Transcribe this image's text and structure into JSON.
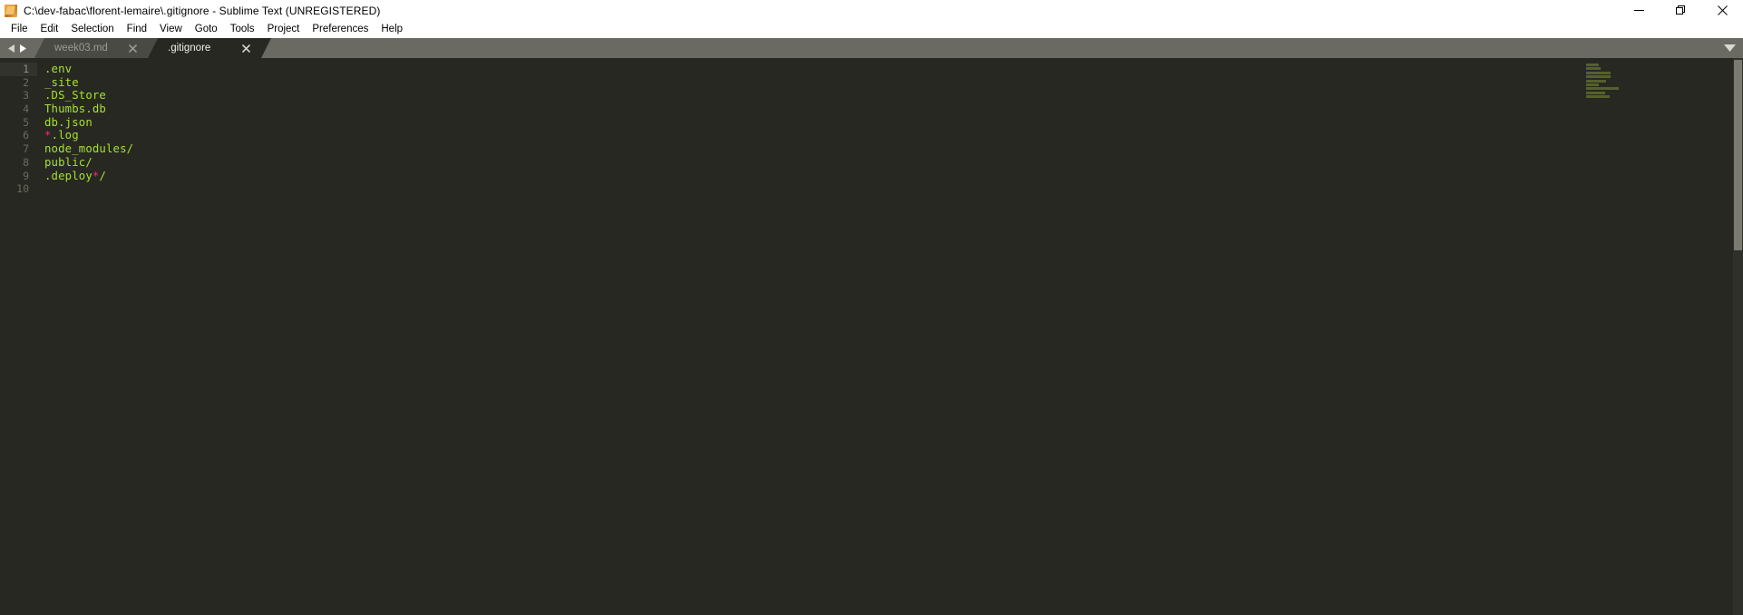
{
  "window": {
    "title": "C:\\dev-fabac\\florent-lemaire\\.gitignore - Sublime Text (UNREGISTERED)",
    "app_icon": "sublime-text-icon",
    "controls": [
      {
        "name": "minimize",
        "glyph": "minimize-icon"
      },
      {
        "name": "restore",
        "glyph": "restore-icon"
      },
      {
        "name": "close",
        "glyph": "close-icon"
      }
    ],
    "titlebar_bg": "#ffffff",
    "titlebar_fg": "#000000"
  },
  "menubar": {
    "items": [
      {
        "label": "File"
      },
      {
        "label": "Edit"
      },
      {
        "label": "Selection"
      },
      {
        "label": "Find"
      },
      {
        "label": "View"
      },
      {
        "label": "Goto"
      },
      {
        "label": "Tools"
      },
      {
        "label": "Project"
      },
      {
        "label": "Preferences"
      },
      {
        "label": "Help"
      }
    ]
  },
  "tabbar": {
    "bg": "#6a6a63",
    "nav_prev_icon": "chevron-left-icon",
    "nav_next_icon": "chevron-right-icon",
    "dropdown_icon": "chevron-down-icon",
    "close_icon": "close-icon",
    "tabs": [
      {
        "label": "week03.md",
        "active": false
      },
      {
        "label": ".gitignore",
        "active": true
      }
    ]
  },
  "editor": {
    "background": "#272822",
    "text_color": "#a6e22e",
    "accent_color": "#f92672",
    "gutter_color": "#6a6a5f",
    "current_line": 1,
    "line_numbers": [
      "1",
      "2",
      "3",
      "4",
      "5",
      "6",
      "7",
      "8",
      "9",
      "10"
    ],
    "lines": [
      {
        "n": "1",
        "segments": [
          {
            "t": ".env",
            "c": "text"
          }
        ]
      },
      {
        "n": "2",
        "segments": [
          {
            "t": "_site",
            "c": "text"
          }
        ]
      },
      {
        "n": "3",
        "segments": [
          {
            "t": ".DS_Store",
            "c": "text"
          }
        ]
      },
      {
        "n": "4",
        "segments": [
          {
            "t": "Thumbs.db",
            "c": "text"
          }
        ]
      },
      {
        "n": "5",
        "segments": [
          {
            "t": "db.json",
            "c": "text"
          }
        ]
      },
      {
        "n": "6",
        "segments": [
          {
            "t": "*",
            "c": "star"
          },
          {
            "t": ".log",
            "c": "text"
          }
        ]
      },
      {
        "n": "7",
        "segments": [
          {
            "t": "node_modules/",
            "c": "text"
          }
        ]
      },
      {
        "n": "8",
        "segments": [
          {
            "t": "public/",
            "c": "text"
          }
        ]
      },
      {
        "n": "9",
        "segments": [
          {
            "t": ".deploy",
            "c": "text"
          },
          {
            "t": "*",
            "c": "star"
          },
          {
            "t": "/",
            "c": "text"
          }
        ]
      },
      {
        "n": "10",
        "segments": []
      }
    ]
  },
  "minimap": {
    "widths": [
      22,
      26,
      44,
      44,
      36,
      22,
      58,
      34,
      42,
      0
    ],
    "star_lines": [
      6,
      9
    ]
  },
  "scrollbar": {
    "name": "vertical-scrollbar"
  }
}
